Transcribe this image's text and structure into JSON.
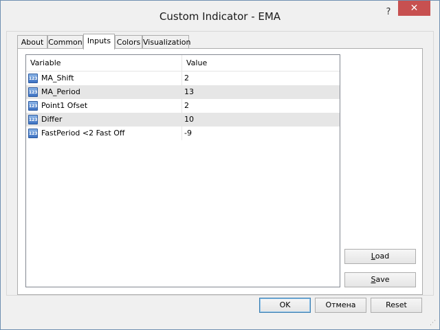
{
  "window": {
    "title": "Custom Indicator - EMA",
    "help_label": "?",
    "close_label": "✕"
  },
  "tabs": [
    {
      "label": "About"
    },
    {
      "label": "Common"
    },
    {
      "label": "Inputs"
    },
    {
      "label": "Colors"
    },
    {
      "label": "Visualization"
    }
  ],
  "active_tab": "Inputs",
  "grid": {
    "headers": {
      "variable": "Variable",
      "value": "Value"
    },
    "icon_text": "123",
    "rows": [
      {
        "variable": "MA_Shift",
        "value": "2"
      },
      {
        "variable": "MA_Period",
        "value": "13"
      },
      {
        "variable": "Point1 Ofset",
        "value": "2"
      },
      {
        "variable": "Differ",
        "value": "10"
      },
      {
        "variable": "FastPeriod <2 Fast Off",
        "value": "-9"
      }
    ]
  },
  "side_buttons": {
    "load_first": "L",
    "load_rest": "oad",
    "save_first": "S",
    "save_rest": "ave"
  },
  "buttons": {
    "ok": "OK",
    "cancel": "Отмена",
    "reset": "Reset"
  }
}
